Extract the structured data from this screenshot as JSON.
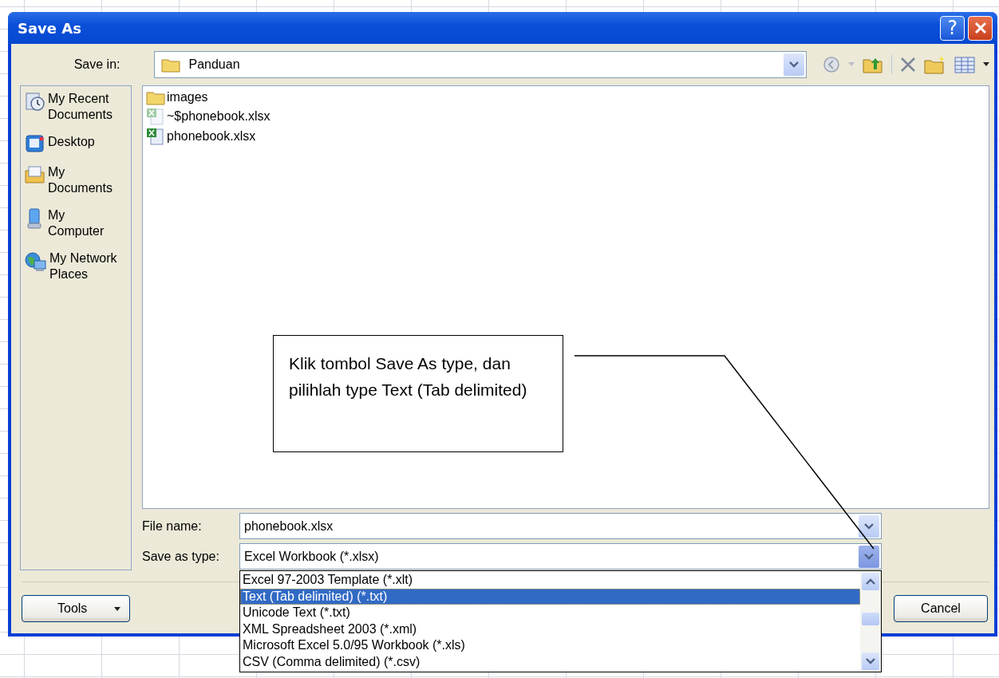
{
  "window": {
    "title": "Save As",
    "help_label": "?"
  },
  "save_in": {
    "label": "Save in:",
    "value": "Panduan"
  },
  "places": [
    {
      "label": "My Recent\nDocuments",
      "kind": "recent"
    },
    {
      "label": "Desktop",
      "kind": "desktop"
    },
    {
      "label": "My\nDocuments",
      "kind": "documents"
    },
    {
      "label": "My\nComputer",
      "kind": "computer"
    },
    {
      "label": "My Network\nPlaces",
      "kind": "network"
    }
  ],
  "files": [
    {
      "name": "images",
      "kind": "folder"
    },
    {
      "name": "~$phonebook.xlsx",
      "kind": "excel-temp"
    },
    {
      "name": "phonebook.xlsx",
      "kind": "excel"
    }
  ],
  "file_name": {
    "label": "File name:",
    "value": "phonebook.xlsx"
  },
  "save_as_type": {
    "label": "Save as type:",
    "value": "Excel Workbook (*.xlsx)",
    "expanded": true,
    "options": [
      {
        "label": "Excel 97-2003 Template (*.xlt)",
        "selected": false
      },
      {
        "label": "Text (Tab delimited) (*.txt)",
        "selected": true
      },
      {
        "label": "Unicode Text (*.txt)",
        "selected": false
      },
      {
        "label": "XML Spreadsheet 2003 (*.xml)",
        "selected": false
      },
      {
        "label": "Microsoft Excel 5.0/95 Workbook (*.xls)",
        "selected": false
      },
      {
        "label": "CSV (Comma delimited) (*.csv)",
        "selected": false
      }
    ]
  },
  "buttons": {
    "tools": "Tools",
    "cancel": "Cancel"
  },
  "callout": {
    "text": "Klik tombol Save As type, dan pilihlah type Text (Tab delimited)"
  }
}
